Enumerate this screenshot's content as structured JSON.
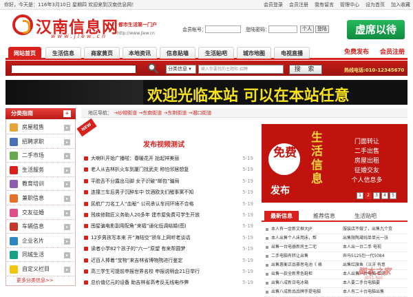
{
  "topbar": {
    "greeting": "你好，今天是：116年3月10日 星期四 欢迎来到汉南信息网！",
    "links": [
      "会员登录",
      "会员注册",
      "我有留言",
      "管理中心",
      "设为首页",
      "加入收藏"
    ]
  },
  "header": {
    "logo": "汉南信息网",
    "logo_url": "www.jlew.cn",
    "slogan": "都市生活第一门户",
    "site_url": "http://www.jlew.cn",
    "login": {
      "account_label": "会员帐号：",
      "password_label": "登陆密码：",
      "personal_label": "个人",
      "login_label": "登陆"
    },
    "ad": "虚席以待"
  },
  "nav": {
    "items": [
      "网站首页",
      "生活信息",
      "商家黄页",
      "本地资讯",
      "信息贴墙",
      "生活贴吧",
      "城市地图",
      "电视直播"
    ],
    "active_index": 0,
    "right": [
      "免费发布",
      "会员注册"
    ]
  },
  "search": {
    "select": "分类信息",
    "placeholder": "输入你要找的主题和 招聘",
    "button": "搜 索",
    "hotline": "热线电话:010-12345670"
  },
  "banner": {
    "text": "欢迎光临本站  可以在本站任意"
  },
  "sidebar": {
    "title": "分类指南",
    "plus": "+",
    "items": [
      {
        "label": "房屋租售",
        "color": "#e8a33a"
      },
      {
        "label": "招聘求职",
        "color": "#4a6fb5"
      },
      {
        "label": "二手市场",
        "color": "#6aa84f"
      },
      {
        "label": "生活服务",
        "color": "#d8211d"
      },
      {
        "label": "教育培训",
        "color": "#8e5bb0"
      },
      {
        "label": "兼职信息",
        "color": "#e8702a"
      },
      {
        "label": "交友征婚",
        "color": "#e04d8a"
      },
      {
        "label": "车辆信息",
        "color": "#c0392b"
      },
      {
        "label": "企业名片",
        "color": "#2e86c1"
      },
      {
        "label": "同城生活",
        "color": "#16a085"
      },
      {
        "label": "自定义栏目",
        "color": "#f1c40f"
      }
    ],
    "arrow": "▸",
    "more": "更多分类信息>>"
  },
  "breadcrumb": {
    "label": "地区导航：",
    "items": [
      "纱帽街道",
      "东南街道",
      "东荆街道",
      "湘口街道"
    ],
    "sep": "→"
  },
  "news": {
    "badge": "NEW",
    "title": "发布视频测试",
    "items": [
      {
        "text": "大喇叭开始广播啦：春暖花开 抬起祥美丽",
        "date": "5-19"
      },
      {
        "text": "老人从吉林扒火车到厦门找武夫 称怕邻居想复",
        "date": "5-19"
      },
      {
        "text": "平脸舌不分露出马脚 女子识破“邮包”骗局",
        "date": "5-19"
      },
      {
        "text": "连撞三车后男子沉醉车中 饮酒欧夫们醒事寓不知",
        "date": "5-19"
      },
      {
        "text": "民航广刀名工人“血秘” 公司承认车间环境不合格",
        "date": "5-19"
      },
      {
        "text": "残疾修鞋匠义务助人20多年 建市屋免费可学生开放",
        "date": "5-19"
      },
      {
        "text": "囤星骗电影副用配角“来福”通化低调结婚(图)",
        "date": "5-19"
      },
      {
        "text": "12岁男孩写本来 开“海陆空”骄车上网听老谈话",
        "date": "5-19"
      },
      {
        "text": "读者小学82个孩子的“六一”原望 有来帮圆梦",
        "date": "5-19"
      },
      {
        "text": "近百人捧着“宝物”来吉林省博物院进行鉴定",
        "date": "5-19"
      },
      {
        "text": "高三学生可提前申报世界名校 申报说明会21日举行",
        "date": "5-19"
      },
      {
        "text": "总价值亿元的设备 助吉林省高考反无线电作弊",
        "date": "5-19"
      }
    ]
  },
  "promo": {
    "free": "免费",
    "publish": "发布",
    "vertical": "生活信息",
    "lines": [
      "门面转让",
      "二手出售",
      "房屋出租",
      "征婚交友",
      "个人信息多"
    ],
    "dots": [
      "1",
      "2",
      "3",
      "4",
      "5"
    ],
    "active_dot": 1
  },
  "tabs": {
    "labels": [
      "最新信息",
      "推荐信息",
      "生活贴吧"
    ],
    "active_index": 0,
    "rows": [
      {
        "left": "本人有一金新文框大JP",
        "right": "服装店不做了，出售九个货"
      },
      {
        "left": "本人出售个人床用床，帮",
        "right": "出售限陶凝纯单单元一张"
      },
      {
        "left": "出售一台电器新房主二宅",
        "right": "本人出一台二手 电视"
      },
      {
        "left": "二手电脑有转让出售",
        "right": "奔马5125包一代5084"
      },
      {
        "left": "出售惠衡正品豪思电池《 格",
        "right": "出售红旗鱼（汪洋 有意"
      },
      {
        "left": "出售一款全新黑色鞋柜",
        "right": "本人出售一台电脑 带完"
      },
      {
        "left": "出售八成新日电冰箱",
        "right": "本人要二手台电脑要"
      },
      {
        "left": "出售八成新品品牌手提电脑",
        "right": "本人有二十台电脑出售"
      }
    ]
  },
  "watermark": {
    "text": "脚本之家",
    "sub": "JB51.Net"
  },
  "colors": {
    "brand_red": "#d8211d",
    "banner_yellow": "#f6e21a",
    "ad_green": "#27b85c"
  }
}
